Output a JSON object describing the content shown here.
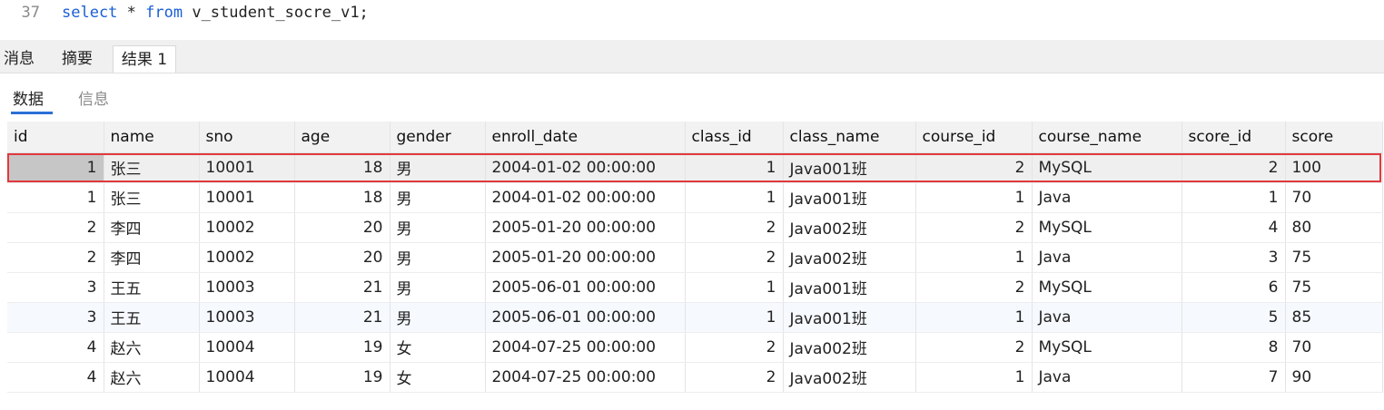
{
  "editor": {
    "line_number": "37",
    "kw_select": "select",
    "star": " * ",
    "kw_from": "from",
    "rest": " v_student_socre_v1;"
  },
  "tabs": [
    {
      "label": "消息"
    },
    {
      "label": "摘要"
    },
    {
      "label": "结果 1"
    }
  ],
  "subtabs": [
    {
      "label": "数据"
    },
    {
      "label": "信息"
    }
  ],
  "table": {
    "columns": [
      "id",
      "name",
      "sno",
      "age",
      "gender",
      "enroll_date",
      "class_id",
      "class_name",
      "course_id",
      "course_name",
      "score_id",
      "score"
    ],
    "rows": [
      [
        "1",
        "张三",
        "10001",
        "18",
        "男",
        "2004-01-02 00:00:00",
        "1",
        "Java001班",
        "2",
        "MySQL",
        "2",
        "100"
      ],
      [
        "1",
        "张三",
        "10001",
        "18",
        "男",
        "2004-01-02 00:00:00",
        "1",
        "Java001班",
        "1",
        "Java",
        "1",
        "70"
      ],
      [
        "2",
        "李四",
        "10002",
        "20",
        "男",
        "2005-01-20 00:00:00",
        "2",
        "Java002班",
        "2",
        "MySQL",
        "4",
        "80"
      ],
      [
        "2",
        "李四",
        "10002",
        "20",
        "男",
        "2005-01-20 00:00:00",
        "2",
        "Java002班",
        "1",
        "Java",
        "3",
        "75"
      ],
      [
        "3",
        "王五",
        "10003",
        "21",
        "男",
        "2005-06-01 00:00:00",
        "1",
        "Java001班",
        "2",
        "MySQL",
        "6",
        "75"
      ],
      [
        "3",
        "王五",
        "10003",
        "21",
        "男",
        "2005-06-01 00:00:00",
        "1",
        "Java001班",
        "1",
        "Java",
        "5",
        "85"
      ],
      [
        "4",
        "赵六",
        "10004",
        "19",
        "女",
        "2004-07-25 00:00:00",
        "2",
        "Java002班",
        "2",
        "MySQL",
        "8",
        "70"
      ],
      [
        "4",
        "赵六",
        "10004",
        "19",
        "女",
        "2004-07-25 00:00:00",
        "2",
        "Java002班",
        "1",
        "Java",
        "7",
        "90"
      ]
    ],
    "numeric_columns": [
      0,
      3,
      6,
      8,
      10
    ],
    "selected_row": 0,
    "alt_row": 5
  },
  "colors": {
    "keyword": "#1a5fd6",
    "highlight_border": "#e0393e",
    "active_subtab_underline": "#2b6fd6"
  }
}
